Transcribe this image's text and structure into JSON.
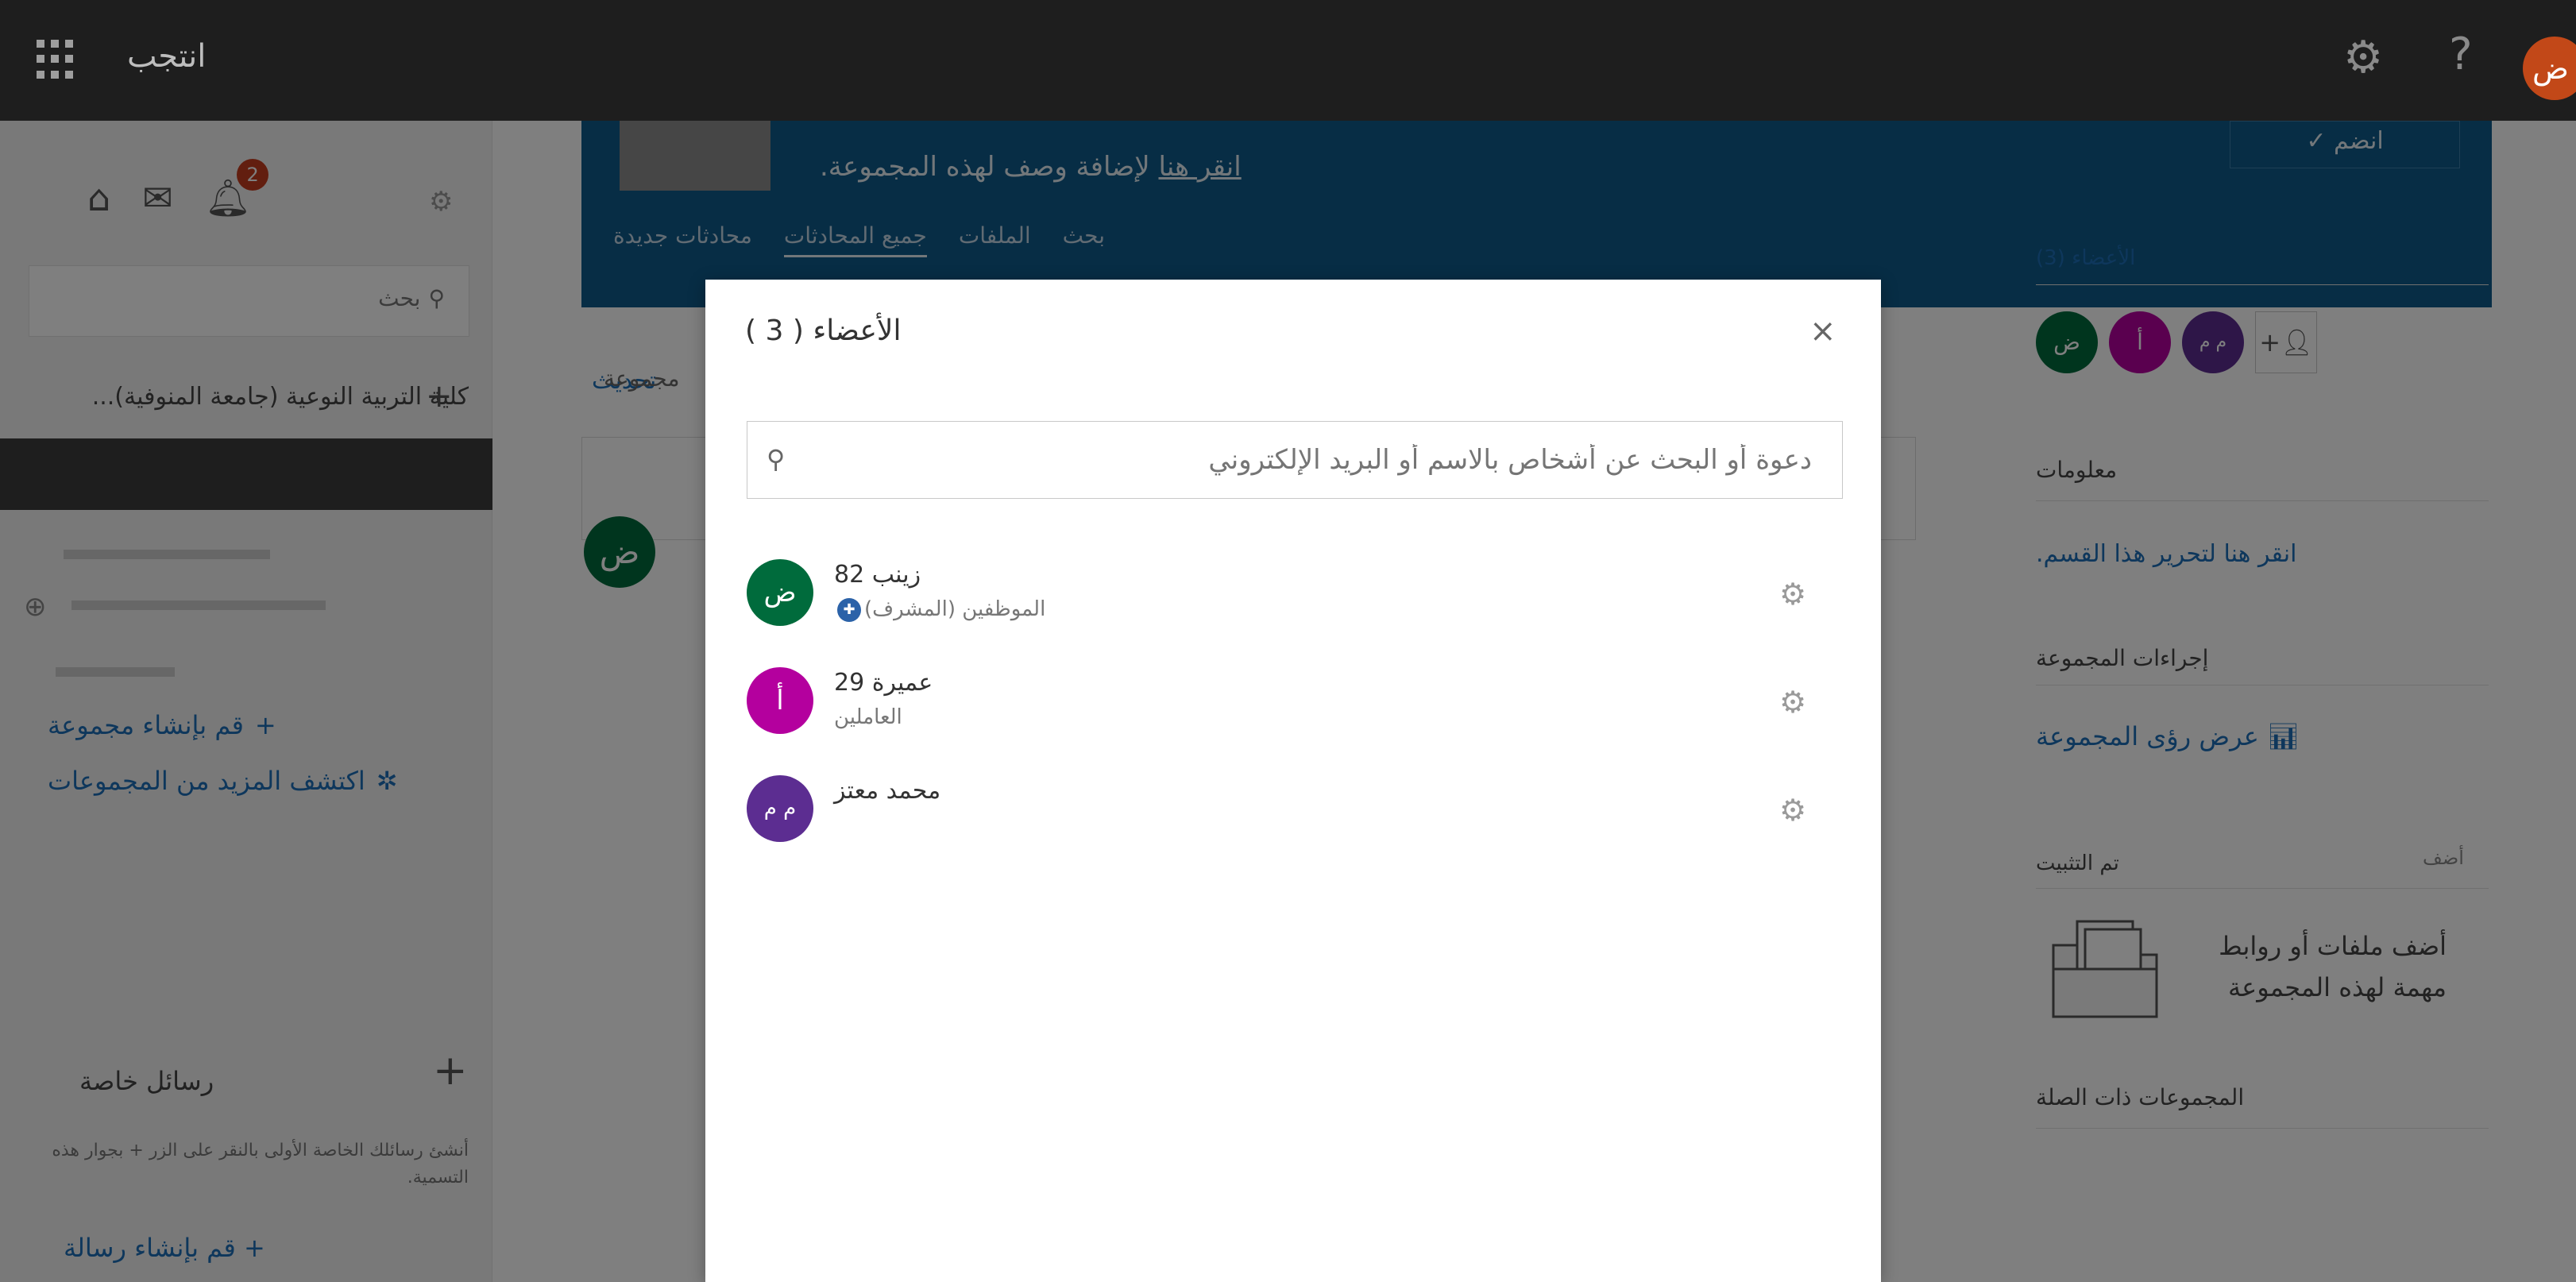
{
  "topbar": {
    "title": "انتجب",
    "avatar_initial": "ض"
  },
  "sidebar": {
    "notification_count": "2",
    "search_placeholder": "بحث",
    "group_name": "...كلية التربية النوعية (جامعة المنوفية)",
    "create_group": "قم بإنشاء مجموعة",
    "discover_groups": "اكتشف المزيد من المجموعات",
    "private_messages_title": "رسائل خاصة",
    "private_messages_body": "أنشئ رسائلك الخاصة الأولى بالنقر على الزر + بجوار هذه التسمية.",
    "create_message": "قم بإنشاء رسالة"
  },
  "banner": {
    "description_link": "انقر هنا",
    "description_rest": " لإضافة وصف لهذه المجموعة.",
    "tabs": [
      "محادثات جديدة",
      "جميع المحادثات",
      "الملفات",
      "بحث"
    ],
    "join_label": "انضم ✓"
  },
  "feed": {
    "update_label": "تحديث",
    "box_text": "مجموعة",
    "avatar_initial": "ض"
  },
  "right_panel": {
    "members_label": "الأعضاء (3)",
    "avatars": [
      {
        "initial": "ض",
        "color": "#006b3c"
      },
      {
        "initial": "أ",
        "color": "#b4009e"
      },
      {
        "initial": "م م",
        "color": "#5c2d91"
      }
    ],
    "info_title": "معلومات",
    "info_edit_link": "انقر هنا لتحرير هذا القسم.",
    "group_actions_title": "إجراءات المجموعة",
    "view_insights": "عرض رؤى المجموعة",
    "pinned_title": "تم التثبيت",
    "pinned_add": "أضف",
    "pinned_text": "أضف ملفات أو روابط مهمة لهذه المجموعة",
    "related_groups_title": "المجموعات ذات الصلة"
  },
  "modal": {
    "title": "الأعضاء ( 3 )",
    "close_label": "×",
    "search_placeholder": "دعوة أو البحث عن أشخاص بالاسم أو البريد الإلكتروني",
    "members": [
      {
        "name": "زينب 82",
        "role": "الموظفين (المشرف)",
        "initial": "ض",
        "color": "#006b3c",
        "admin": true
      },
      {
        "name": "عميرة 29",
        "role": "العاملين",
        "initial": "أ",
        "color": "#b4009e",
        "admin": false
      },
      {
        "name": "محمد معتز",
        "role": "",
        "initial": "م م",
        "color": "#5c2d91",
        "admin": false
      }
    ]
  }
}
